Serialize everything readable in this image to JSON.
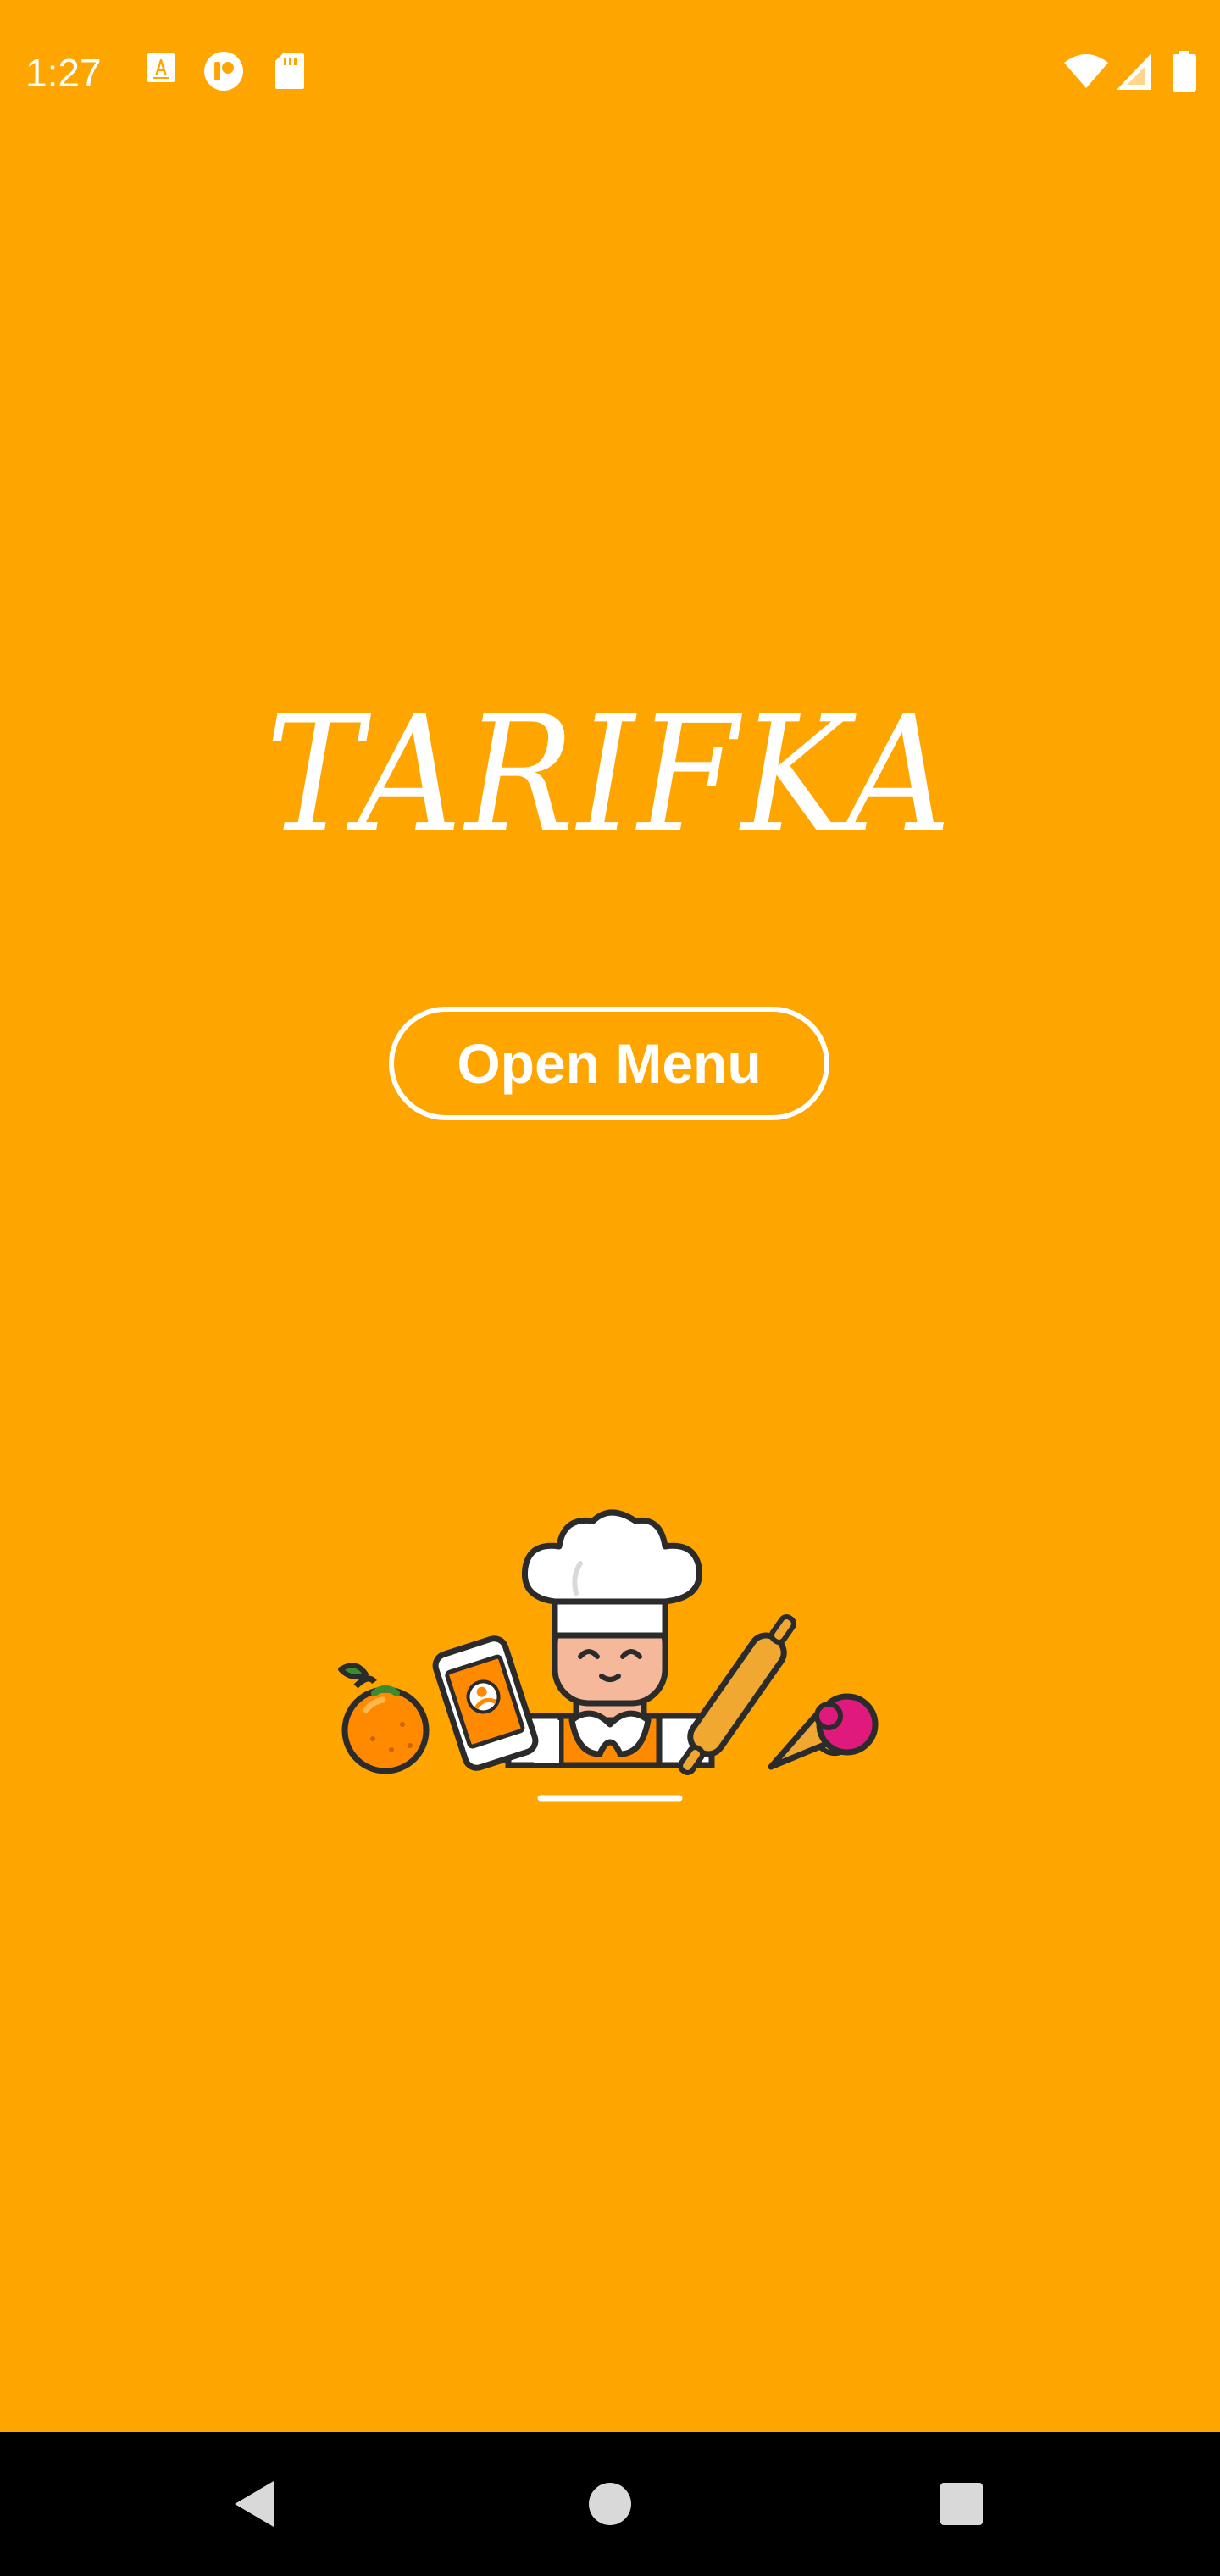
{
  "status_bar": {
    "time": "1:27",
    "left_icons": [
      "a-notification-icon",
      "record-icon",
      "sd-card-icon"
    ],
    "right_icons": [
      "wifi-icon",
      "signal-icon",
      "battery-icon"
    ]
  },
  "app": {
    "title": "TARIFKA",
    "open_menu_label": "Open Menu",
    "background_color": "#FFA500",
    "illustration": "chef-with-food-icon"
  },
  "nav_bar": {
    "buttons": [
      "back-icon",
      "home-icon",
      "recents-icon"
    ]
  }
}
